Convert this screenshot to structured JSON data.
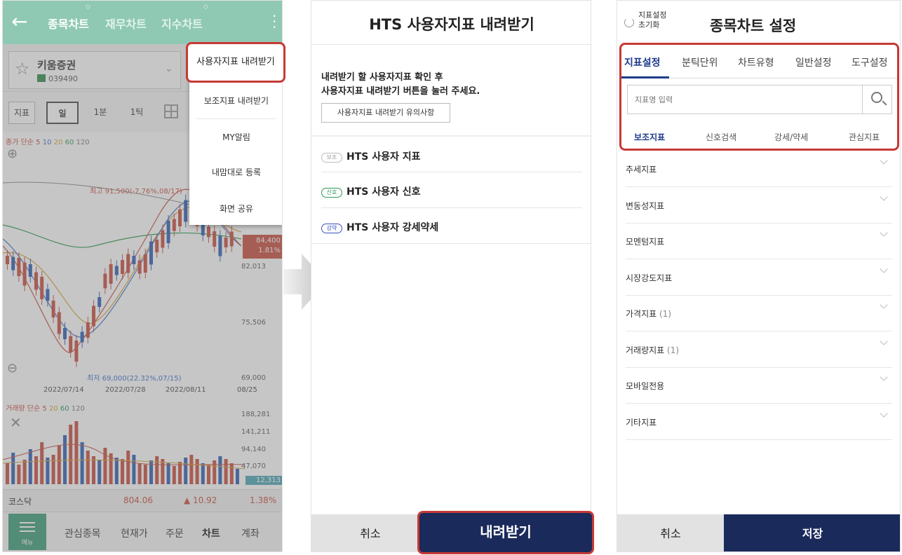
{
  "screen1": {
    "header": {
      "back_icon": "←",
      "tabs": [
        "종목차트",
        "재무차트",
        "지수차트"
      ],
      "kebab_icon": "⋮"
    },
    "stock": {
      "name": "키움증권",
      "code": "039490"
    },
    "toolbar": {
      "indicator": "지표",
      "day": "일",
      "min": "1분",
      "tick": "1틱"
    },
    "ma_legend": [
      "종가 단순",
      "5",
      "10",
      "20",
      "60",
      "120"
    ],
    "high_label": "최고 91,500(-7.76%,08/17)",
    "low_label": "최저 69,000(22.32%,07/15)",
    "price_axis": [
      "82,013",
      "75,506",
      "69,000"
    ],
    "price_badge": [
      "84,400",
      "1.81%"
    ],
    "dates": [
      "2022/07/14",
      "2022/07/28",
      "2022/08/11",
      "08/25"
    ],
    "vol_legend": [
      "거래량 단순",
      "5",
      "20",
      "60",
      "120"
    ],
    "vol_axis": [
      "188,281",
      "141,211",
      "94,140",
      "47,070"
    ],
    "vol_badge": "12,313",
    "ticker": {
      "name": "코스닥",
      "value": "804.06",
      "change": "▲ 10.92",
      "rate": "1.38%"
    },
    "bottom_nav": {
      "menu": "메뉴",
      "items": [
        "관심종목",
        "현재가",
        "주문",
        "차트",
        "계좌"
      ]
    },
    "dropdown": [
      "사용자지표 내려받기",
      "보조지표 내려받기",
      "MY알림",
      "내맘대로 등록",
      "화면 공유"
    ]
  },
  "screen2": {
    "title": "HTS 사용자지표 내려받기",
    "instruction": [
      "내려받기 할 사용자지표 확인 후",
      "사용자지표 내려받기 버튼을 눌러 주세요."
    ],
    "notice_button": "사용자지표 내려받기 유의사항",
    "items": [
      {
        "badge": "보조",
        "label": "HTS 사용자 지표"
      },
      {
        "badge": "신호",
        "label": "HTS 사용자 신호"
      },
      {
        "badge": "강약",
        "label": "HTS 사용자 강세약세"
      }
    ],
    "cancel": "취소",
    "download": "내려받기"
  },
  "screen3": {
    "reset": [
      "지표설정",
      "초기화"
    ],
    "title": "종목차트 설정",
    "tabs": [
      "지표설정",
      "분틱단위",
      "차트유형",
      "일반설정",
      "도구설정"
    ],
    "search_placeholder": "지표명 입력",
    "subtabs": [
      "보조지표",
      "신호검색",
      "강세/약세",
      "관심지표"
    ],
    "categories": [
      {
        "label": "추세지표",
        "count": ""
      },
      {
        "label": "변동성지표",
        "count": ""
      },
      {
        "label": "모멘텀지표",
        "count": ""
      },
      {
        "label": "시장강도지표",
        "count": ""
      },
      {
        "label": "가격지표",
        "count": "(1)"
      },
      {
        "label": "거래량지표",
        "count": "(1)"
      },
      {
        "label": "모바일전용",
        "count": ""
      },
      {
        "label": "기타지표",
        "count": ""
      }
    ],
    "cancel": "취소",
    "save": "저장"
  },
  "colors": {
    "header_green": "#8fc9b3",
    "accent_navy": "#1a2a5b",
    "highlight_red": "#c63a35",
    "candle_up": "#c94a3c",
    "candle_down": "#2b5cb3"
  }
}
